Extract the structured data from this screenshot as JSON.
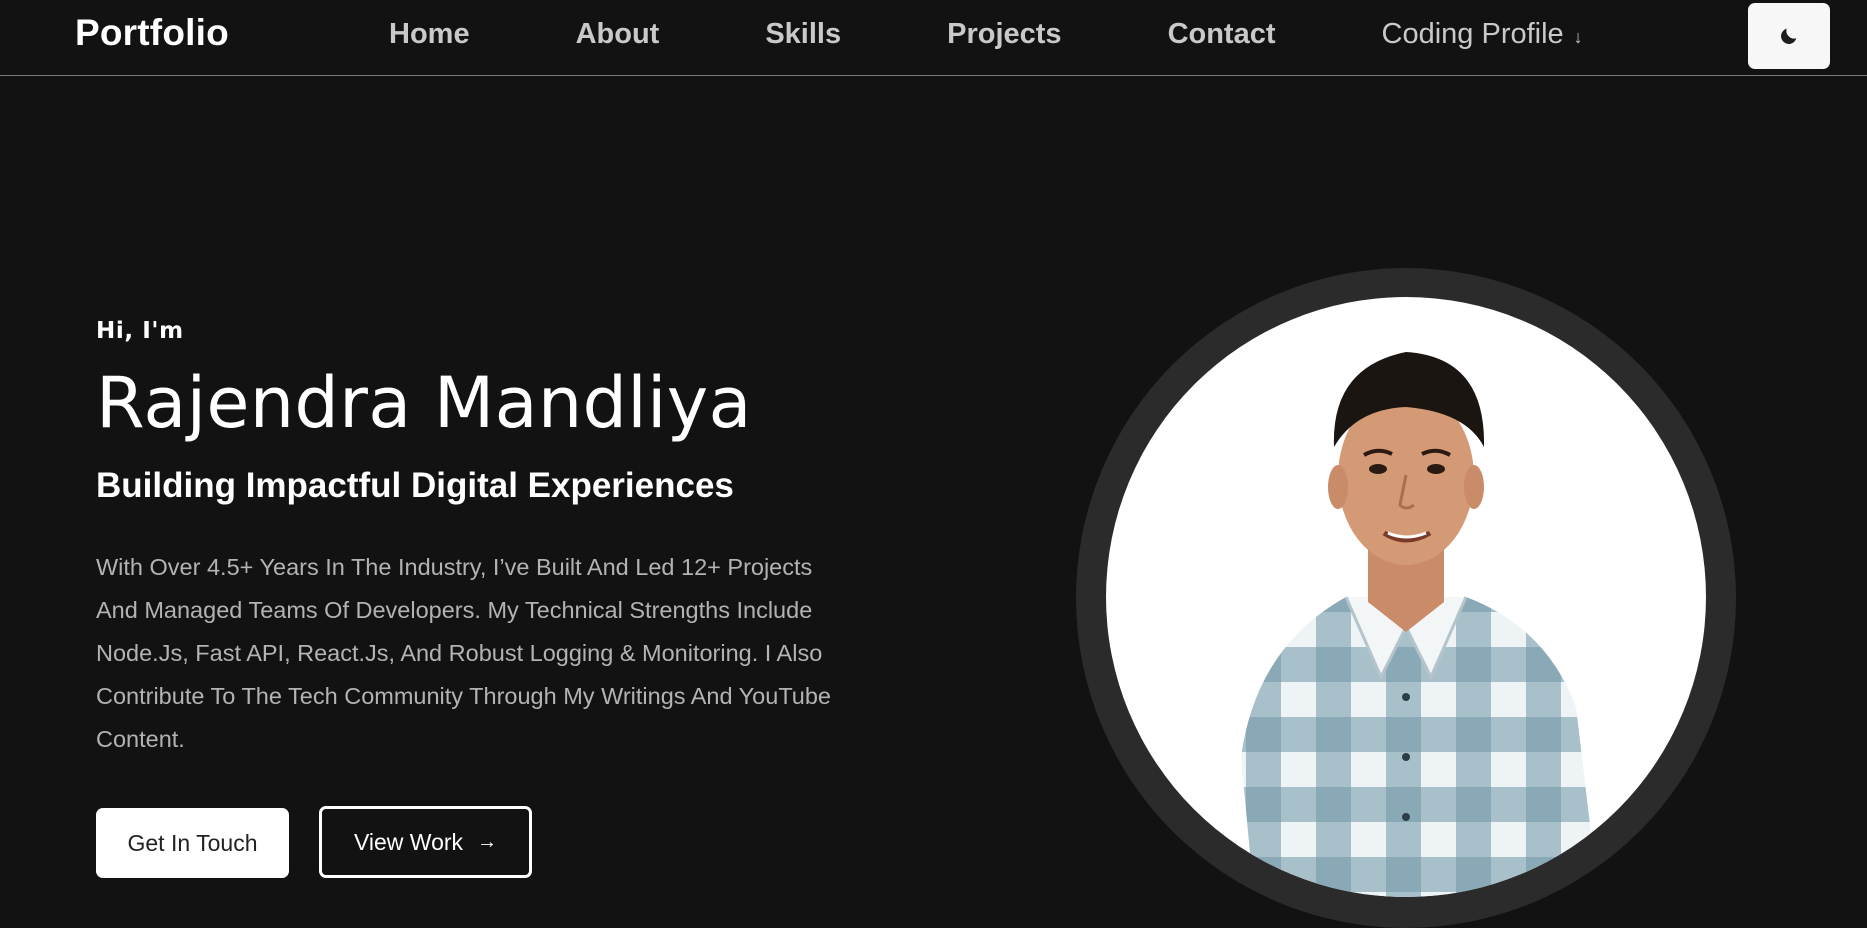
{
  "nav": {
    "brand": "Portfolio",
    "links": [
      {
        "label": "Home"
      },
      {
        "label": "About"
      },
      {
        "label": "Skills"
      },
      {
        "label": "Projects"
      },
      {
        "label": "Contact"
      }
    ],
    "coding_profile": "Coding Profile",
    "coding_profile_icon": "arrow-down-icon",
    "theme_toggle_icon": "moon-icon"
  },
  "hero": {
    "greeting": "Hi, I'm",
    "name": "Rajendra Mandliya",
    "tagline": "Building Impactful Digital Experiences",
    "bio": "With Over 4.5+ Years In The Industry, I’ve Built And Led 12+ Projects And Managed Teams Of Developers. My Technical Strengths Include Node.Js, Fast API, React.Js, And Robust Logging & Monitoring. I Also Contribute To The Tech Community Through My Writings And YouTube Content.",
    "primary_button": "Get In Touch",
    "secondary_button": "View Work",
    "secondary_button_icon": "arrow-right-icon"
  },
  "colors": {
    "background": "#121212",
    "text": "#ffffff",
    "muted_text": "#b3b3b3",
    "nav_text": "#c9c9c9",
    "ring": "#2b2b2b"
  }
}
